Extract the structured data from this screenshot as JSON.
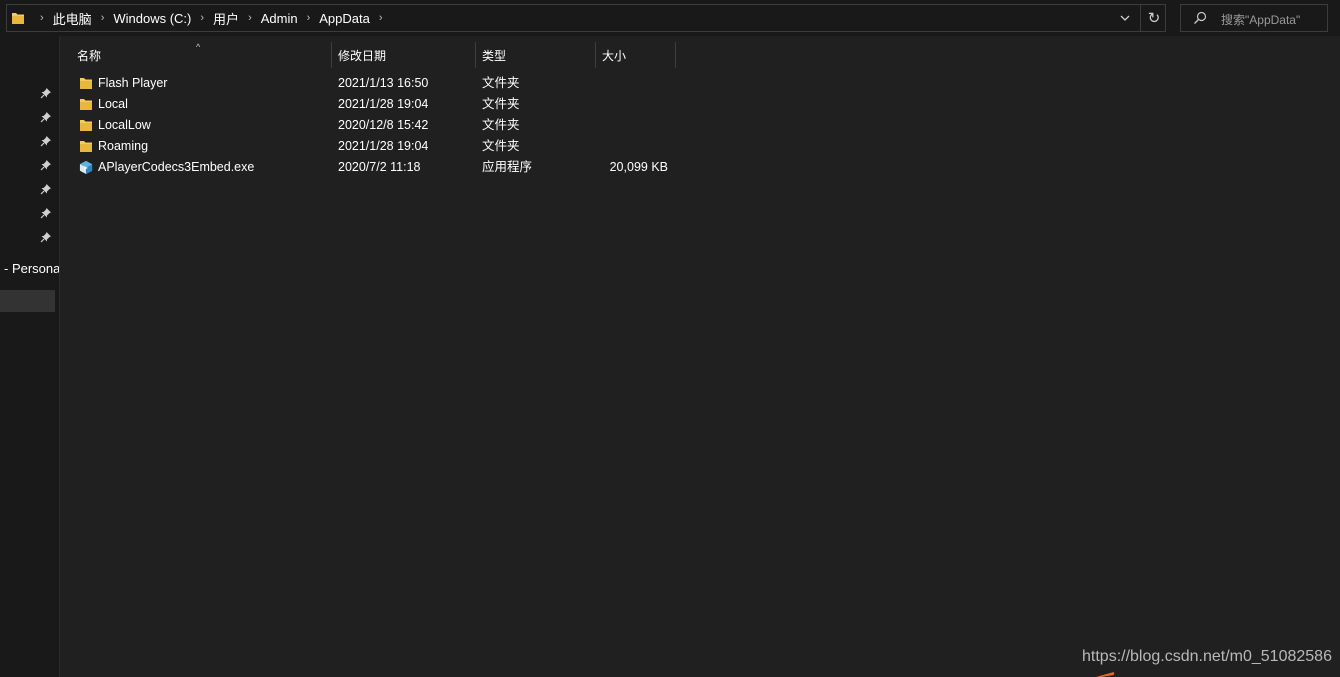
{
  "address_bar": {
    "breadcrumbs": [
      "此电脑",
      "Windows (C:)",
      "用户",
      "Admin",
      "AppData"
    ],
    "separator": "›",
    "refresh_glyph": "↻",
    "icons": {
      "location": "folder-icon",
      "dropdown": "chevron-down-icon",
      "refresh": "refresh-icon"
    }
  },
  "search": {
    "placeholder": "搜索\"AppData\"",
    "icon": "search-icon"
  },
  "nav_pane": {
    "pinned_icon": "pin-icon",
    "pinned_count": 7,
    "partial_item_label": "- Persona"
  },
  "file_list": {
    "sort_indicator": "^",
    "columns": [
      {
        "label": "名称"
      },
      {
        "label": "修改日期"
      },
      {
        "label": "类型"
      },
      {
        "label": "大小"
      }
    ],
    "items": [
      {
        "name": "Flash Player",
        "modified": "2021/1/13 16:50",
        "type": "文件夹",
        "size": "",
        "icon": "folder-icon"
      },
      {
        "name": "Local",
        "modified": "2021/1/28 19:04",
        "type": "文件夹",
        "size": "",
        "icon": "folder-icon"
      },
      {
        "name": "LocalLow",
        "modified": "2020/12/8 15:42",
        "type": "文件夹",
        "size": "",
        "icon": "folder-icon"
      },
      {
        "name": "Roaming",
        "modified": "2021/1/28 19:04",
        "type": "文件夹",
        "size": "",
        "icon": "folder-icon"
      },
      {
        "name": "APlayerCodecs3Embed.exe",
        "modified": "2020/7/2 11:18",
        "type": "应用程序",
        "size": "20,099 KB",
        "icon": "application-icon"
      }
    ]
  },
  "watermark": "https://blog.csdn.net/m0_51082586",
  "colors": {
    "background": "#191919",
    "content_background": "#202020",
    "text": "#ffffff",
    "folder": "#f3cc5c",
    "selection": "#333333"
  }
}
